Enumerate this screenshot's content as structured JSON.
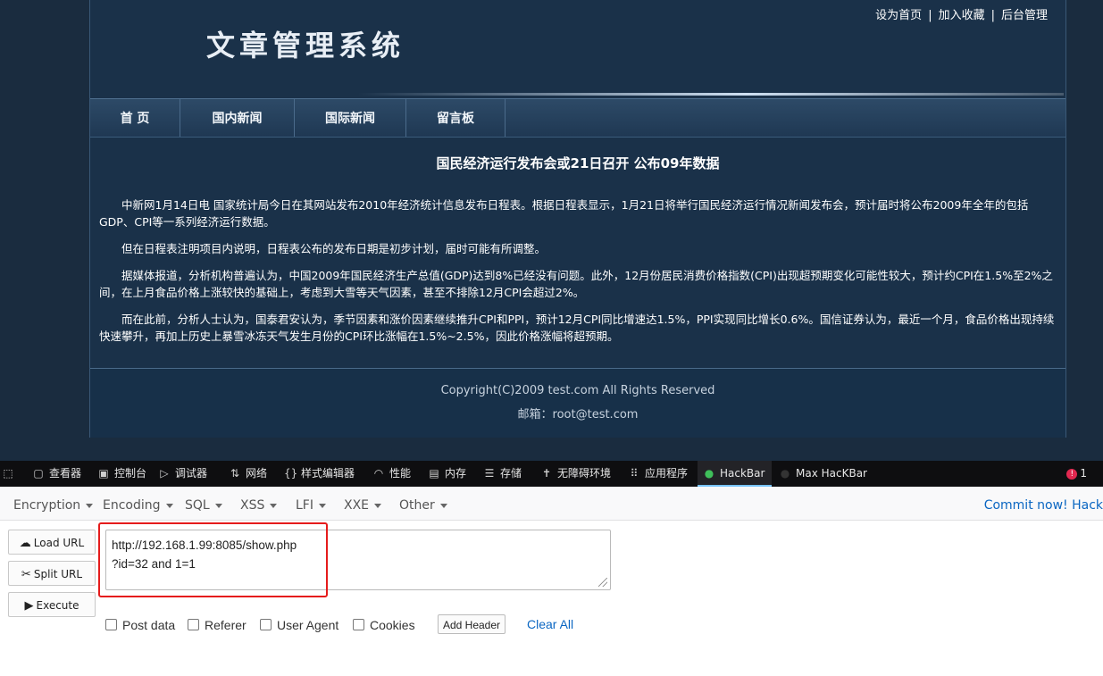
{
  "site": {
    "top_links": [
      "设为首页",
      "加入收藏",
      "后台管理"
    ],
    "title": "文章管理系统",
    "nav": [
      "首 页",
      "国内新闻",
      "国际新闻",
      "留言板"
    ],
    "article": {
      "title": "国民经济运行发布会或21日召开 公布09年数据",
      "paragraphs": [
        "中新网1月14日电 国家统计局今日在其网站发布2010年经济统计信息发布日程表。根据日程表显示，1月21日将举行国民经济运行情况新闻发布会，预计届时将公布2009年全年的包括GDP、CPI等一系列经济运行数据。",
        "但在日程表注明项目内说明，日程表公布的发布日期是初步计划，届时可能有所调整。",
        "据媒体报道，分析机构普遍认为，中国2009年国民经济生产总值(GDP)达到8%已经没有问题。此外，12月份居民消费价格指数(CPI)出现超预期变化可能性较大，预计约CPI在1.5%至2%之间，在上月食品价格上涨较快的基础上，考虑到大雪等天气因素，甚至不排除12月CPI会超过2%。",
        "而在此前，分析人士认为，国泰君安认为，季节因素和涨价因素继续推升CPI和PPI，预计12月CPI同比增速达1.5%，PPI实现同比增长0.6%。国信证券认为，最近一个月，食品价格出现持续快速攀升，再加上历史上暴雪冰冻天气发生月份的CPI环比涨幅在1.5%~2.5%，因此价格涨幅将超预期。"
      ]
    },
    "footer": {
      "copyright": "Copyright(C)2009 test.com All Rights Reserved",
      "email": "邮箱：root@test.com"
    }
  },
  "devtools": {
    "tabs": [
      {
        "label": "查看器",
        "icon": "inspector-icon"
      },
      {
        "label": "控制台",
        "icon": "console-icon"
      },
      {
        "label": "调试器",
        "icon": "debugger-icon"
      },
      {
        "label": "网络",
        "icon": "network-icon"
      },
      {
        "label": "样式编辑器",
        "icon": "style-editor-icon"
      },
      {
        "label": "性能",
        "icon": "performance-icon"
      },
      {
        "label": "内存",
        "icon": "memory-icon"
      },
      {
        "label": "存储",
        "icon": "storage-icon"
      },
      {
        "label": "无障碍环境",
        "icon": "accessibility-icon"
      },
      {
        "label": "应用程序",
        "icon": "application-icon"
      },
      {
        "label": "HackBar",
        "icon": "hackbar-icon"
      },
      {
        "label": "Max HacKBar",
        "icon": "max-hackbar-icon"
      }
    ],
    "active_tab": "HackBar",
    "error_count": "1"
  },
  "hackbar": {
    "menu": [
      "Encryption",
      "Encoding",
      "SQL",
      "XSS",
      "LFI",
      "XXE",
      "Other"
    ],
    "commit": "Commit now! Hack",
    "buttons": {
      "load_url": "Load URL",
      "split_url": "Split URL",
      "execute": "Execute"
    },
    "url_value": "http://192.168.1.99:8085/show.php\n?id=32 and 1=1",
    "options": [
      "Post data",
      "Referer",
      "User Agent",
      "Cookies"
    ],
    "add_header": "Add Header",
    "clear_all": "Clear All"
  },
  "colors": {
    "site_bg": "#1a2c3f",
    "devtools_bg": "#0e0e10",
    "highlight": "#e51c1c",
    "link_blue": "#0a66c2"
  }
}
